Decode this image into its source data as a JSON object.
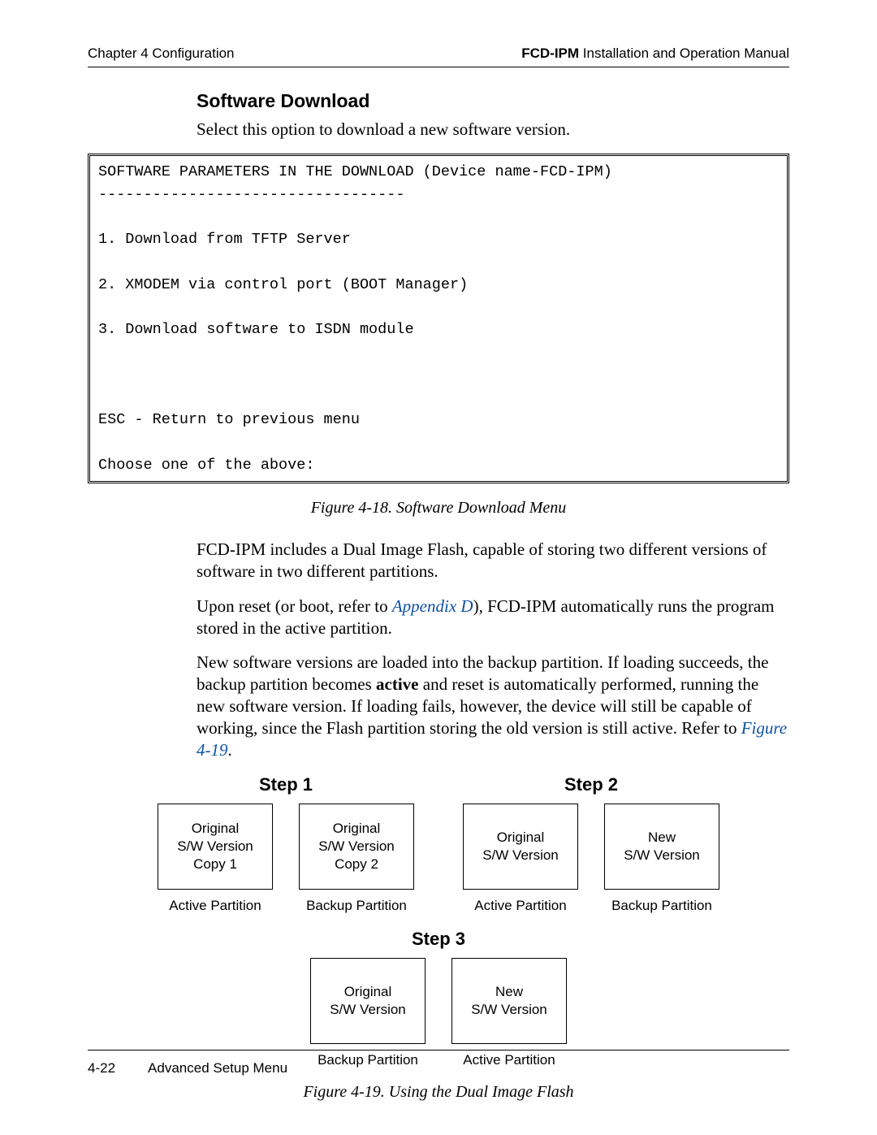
{
  "header": {
    "left": "Chapter 4  Configuration",
    "right_bold": "FCD-IPM",
    "right_tail": " Installation and Operation Manual"
  },
  "section_title": "Software Download",
  "intro": "Select this option to download a new software version.",
  "terminal": "SOFTWARE PARAMETERS IN THE DOWNLOAD (Device name-FCD-IPM)\n----------------------------------\n\n1. Download from TFTP Server\n\n2. XMODEM via control port (BOOT Manager)\n\n3. Download software to ISDN module\n\n\n\nESC - Return to previous menu\n\nChoose one of the above:",
  "fig18_caption": "Figure 4-18.  Software Download Menu",
  "para1": "FCD-IPM includes a Dual Image Flash, capable of storing two different versions of software in two different partitions.",
  "para2_pre": "Upon reset (or boot, refer to ",
  "para2_link": "Appendix D",
  "para2_post": "), FCD-IPM automatically runs the program stored in the active partition.",
  "para3_pre": "New software versions are loaded into the backup partition. If loading succeeds, the backup partition becomes ",
  "para3_bold": "active",
  "para3_mid": " and reset is automatically performed, running the new software version. If loading fails, however, the device will still be capable of working, since the Flash partition storing the old version is still active. Refer to ",
  "para3_link": "Figure 4-19",
  "para3_end": ".",
  "diagram": {
    "step1_title": "Step 1",
    "step2_title": "Step 2",
    "step3_title": "Step 3",
    "b1a": "Original\nS/W Version\nCopy 1",
    "b1b": "Original\nS/W Version\nCopy 2",
    "b2a": "Original\nS/W Version",
    "b2b": "New\nS/W Version",
    "b3a": "Original\nS/W Version",
    "b3b": "New\nS/W Version",
    "active": "Active Partition",
    "backup": "Backup Partition"
  },
  "fig19_caption": "Figure 4-19.  Using the Dual Image Flash",
  "footer": {
    "pagenum": "4-22",
    "title": "Advanced Setup Menu"
  }
}
